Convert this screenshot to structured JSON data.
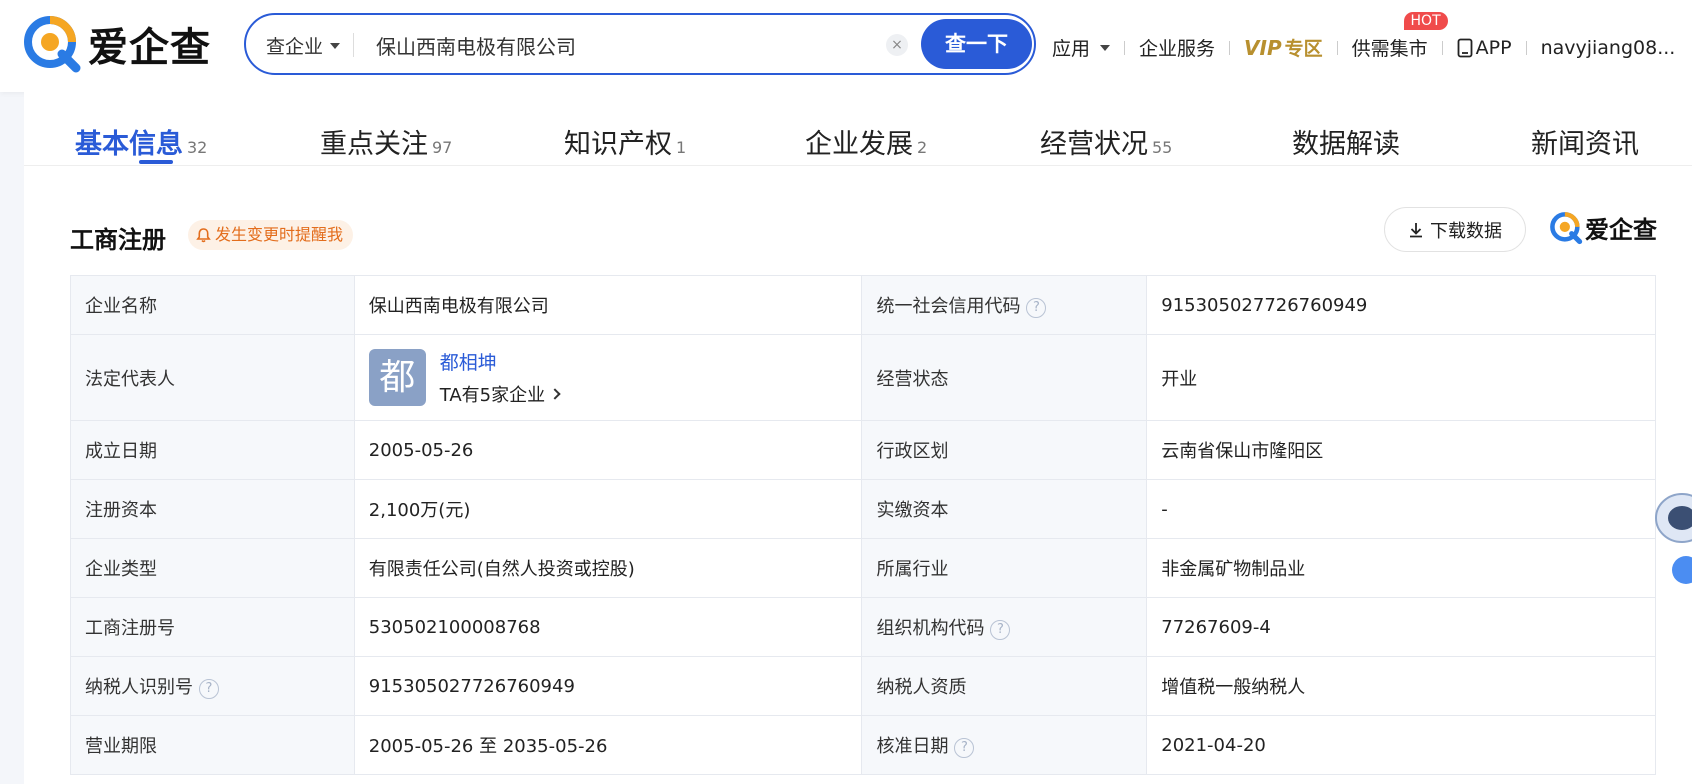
{
  "header": {
    "logo_text": "爱企查",
    "search_type": "查企业",
    "search_value": "保山西南电极有限公司",
    "clear_symbol": "×",
    "search_button": "查一下",
    "nav": {
      "apps": "应用",
      "enterprise_service": "企业服务",
      "vip": "VIP",
      "vip_zone": "专区",
      "supply": "供需集市",
      "hot_badge": "HOT",
      "app": "APP",
      "user": "navyjiang08..."
    }
  },
  "tabs": [
    {
      "label": "基本信息",
      "count": "32"
    },
    {
      "label": "重点关注",
      "count": "97"
    },
    {
      "label": "知识产权",
      "count": "1"
    },
    {
      "label": "企业发展",
      "count": "2"
    },
    {
      "label": "经营状况",
      "count": "55"
    },
    {
      "label": "数据解读",
      "count": ""
    },
    {
      "label": "新闻资讯",
      "count": ""
    }
  ],
  "section": {
    "title": "工商注册",
    "remind": "发生变更时提醒我",
    "download": "下载数据",
    "brand": "爱企查"
  },
  "rows": [
    {
      "l1": "企业名称",
      "v1": "保山西南电极有限公司",
      "l2": "统一社会信用代码",
      "v2": "915305027726760949"
    },
    {
      "l1": "法定代表人",
      "avatar_char": "都",
      "person_name": "都相坤",
      "person_sub": "TA有5家企业",
      "l2": "经营状态",
      "v2": "开业"
    },
    {
      "l1": "成立日期",
      "v1": "2005-05-26",
      "l2": "行政区划",
      "v2": "云南省保山市隆阳区"
    },
    {
      "l1": "注册资本",
      "v1": "2,100万(元)",
      "l2": "实缴资本",
      "v2": "-"
    },
    {
      "l1": "企业类型",
      "v1": "有限责任公司(自然人投资或控股)",
      "l2": "所属行业",
      "v2": "非金属矿物制品业"
    },
    {
      "l1": "工商注册号",
      "v1": "530502100008768",
      "l2": "组织机构代码",
      "v2": "77267609-4"
    },
    {
      "l1": "纳税人识别号",
      "v1": "915305027726760949",
      "l2": "纳税人资质",
      "v2": "增值税一般纳税人"
    },
    {
      "l1": "营业期限",
      "v1": "2005-05-26 至 2035-05-26",
      "l2": "核准日期",
      "v2": "2021-04-20"
    }
  ],
  "help_symbol": "?",
  "colors": {
    "brand_blue": "#2a5bd7",
    "logo_orange": "#f5a623",
    "vip_gold": "#b8902f",
    "hot_red": "#f04b4b"
  }
}
